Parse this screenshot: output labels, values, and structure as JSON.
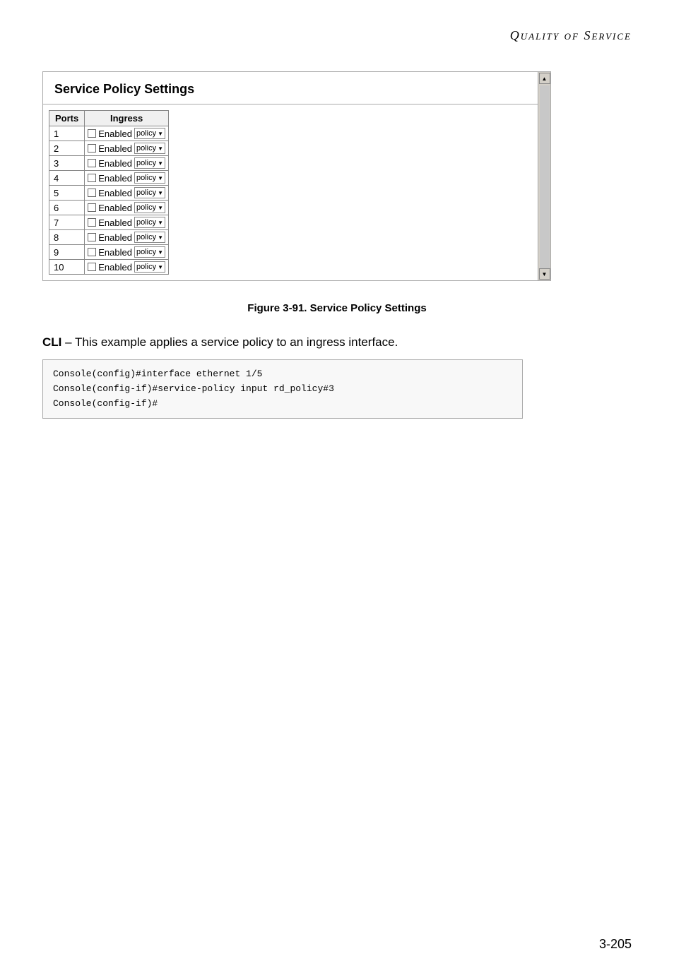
{
  "header": {
    "title": "Quality of Service"
  },
  "settings_box": {
    "title": "Service Policy Settings",
    "table": {
      "col_ports": "Ports",
      "col_ingress": "Ingress",
      "rows": [
        {
          "port": "1"
        },
        {
          "port": "2"
        },
        {
          "port": "3"
        },
        {
          "port": "4"
        },
        {
          "port": "5"
        },
        {
          "port": "6"
        },
        {
          "port": "7"
        },
        {
          "port": "8"
        },
        {
          "port": "9"
        },
        {
          "port": "10"
        }
      ],
      "ingress_enabled_label": "Enabled",
      "ingress_policy_label": "policy"
    }
  },
  "figure_caption": "Figure 3-91.  Service Policy Settings",
  "cli_section": {
    "heading_bold": "CLI",
    "heading_text": " – This example applies a service policy to an ingress interface.",
    "code_lines": [
      "Console(config)#interface ethernet 1/5",
      "Console(config-if)#service-policy input rd_policy#3",
      "Console(config-if)#"
    ]
  },
  "page_number": "3-205"
}
